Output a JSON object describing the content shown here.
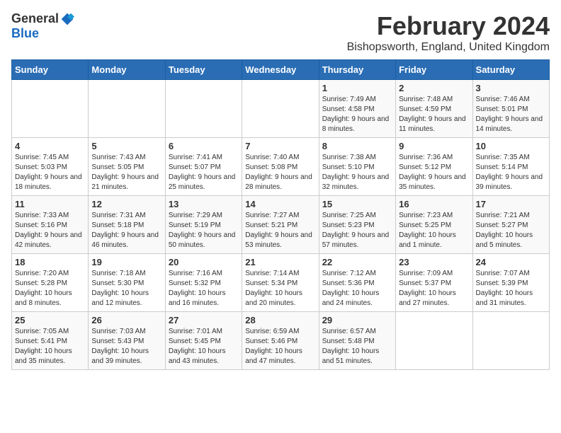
{
  "logo": {
    "general": "General",
    "blue": "Blue"
  },
  "title": "February 2024",
  "location": "Bishopsworth, England, United Kingdom",
  "days_of_week": [
    "Sunday",
    "Monday",
    "Tuesday",
    "Wednesday",
    "Thursday",
    "Friday",
    "Saturday"
  ],
  "weeks": [
    [
      {
        "day": "",
        "info": ""
      },
      {
        "day": "",
        "info": ""
      },
      {
        "day": "",
        "info": ""
      },
      {
        "day": "",
        "info": ""
      },
      {
        "day": "1",
        "info": "Sunrise: 7:49 AM\nSunset: 4:58 PM\nDaylight: 9 hours and 8 minutes."
      },
      {
        "day": "2",
        "info": "Sunrise: 7:48 AM\nSunset: 4:59 PM\nDaylight: 9 hours and 11 minutes."
      },
      {
        "day": "3",
        "info": "Sunrise: 7:46 AM\nSunset: 5:01 PM\nDaylight: 9 hours and 14 minutes."
      }
    ],
    [
      {
        "day": "4",
        "info": "Sunrise: 7:45 AM\nSunset: 5:03 PM\nDaylight: 9 hours and 18 minutes."
      },
      {
        "day": "5",
        "info": "Sunrise: 7:43 AM\nSunset: 5:05 PM\nDaylight: 9 hours and 21 minutes."
      },
      {
        "day": "6",
        "info": "Sunrise: 7:41 AM\nSunset: 5:07 PM\nDaylight: 9 hours and 25 minutes."
      },
      {
        "day": "7",
        "info": "Sunrise: 7:40 AM\nSunset: 5:08 PM\nDaylight: 9 hours and 28 minutes."
      },
      {
        "day": "8",
        "info": "Sunrise: 7:38 AM\nSunset: 5:10 PM\nDaylight: 9 hours and 32 minutes."
      },
      {
        "day": "9",
        "info": "Sunrise: 7:36 AM\nSunset: 5:12 PM\nDaylight: 9 hours and 35 minutes."
      },
      {
        "day": "10",
        "info": "Sunrise: 7:35 AM\nSunset: 5:14 PM\nDaylight: 9 hours and 39 minutes."
      }
    ],
    [
      {
        "day": "11",
        "info": "Sunrise: 7:33 AM\nSunset: 5:16 PM\nDaylight: 9 hours and 42 minutes."
      },
      {
        "day": "12",
        "info": "Sunrise: 7:31 AM\nSunset: 5:18 PM\nDaylight: 9 hours and 46 minutes."
      },
      {
        "day": "13",
        "info": "Sunrise: 7:29 AM\nSunset: 5:19 PM\nDaylight: 9 hours and 50 minutes."
      },
      {
        "day": "14",
        "info": "Sunrise: 7:27 AM\nSunset: 5:21 PM\nDaylight: 9 hours and 53 minutes."
      },
      {
        "day": "15",
        "info": "Sunrise: 7:25 AM\nSunset: 5:23 PM\nDaylight: 9 hours and 57 minutes."
      },
      {
        "day": "16",
        "info": "Sunrise: 7:23 AM\nSunset: 5:25 PM\nDaylight: 10 hours and 1 minute."
      },
      {
        "day": "17",
        "info": "Sunrise: 7:21 AM\nSunset: 5:27 PM\nDaylight: 10 hours and 5 minutes."
      }
    ],
    [
      {
        "day": "18",
        "info": "Sunrise: 7:20 AM\nSunset: 5:28 PM\nDaylight: 10 hours and 8 minutes."
      },
      {
        "day": "19",
        "info": "Sunrise: 7:18 AM\nSunset: 5:30 PM\nDaylight: 10 hours and 12 minutes."
      },
      {
        "day": "20",
        "info": "Sunrise: 7:16 AM\nSunset: 5:32 PM\nDaylight: 10 hours and 16 minutes."
      },
      {
        "day": "21",
        "info": "Sunrise: 7:14 AM\nSunset: 5:34 PM\nDaylight: 10 hours and 20 minutes."
      },
      {
        "day": "22",
        "info": "Sunrise: 7:12 AM\nSunset: 5:36 PM\nDaylight: 10 hours and 24 minutes."
      },
      {
        "day": "23",
        "info": "Sunrise: 7:09 AM\nSunset: 5:37 PM\nDaylight: 10 hours and 27 minutes."
      },
      {
        "day": "24",
        "info": "Sunrise: 7:07 AM\nSunset: 5:39 PM\nDaylight: 10 hours and 31 minutes."
      }
    ],
    [
      {
        "day": "25",
        "info": "Sunrise: 7:05 AM\nSunset: 5:41 PM\nDaylight: 10 hours and 35 minutes."
      },
      {
        "day": "26",
        "info": "Sunrise: 7:03 AM\nSunset: 5:43 PM\nDaylight: 10 hours and 39 minutes."
      },
      {
        "day": "27",
        "info": "Sunrise: 7:01 AM\nSunset: 5:45 PM\nDaylight: 10 hours and 43 minutes."
      },
      {
        "day": "28",
        "info": "Sunrise: 6:59 AM\nSunset: 5:46 PM\nDaylight: 10 hours and 47 minutes."
      },
      {
        "day": "29",
        "info": "Sunrise: 6:57 AM\nSunset: 5:48 PM\nDaylight: 10 hours and 51 minutes."
      },
      {
        "day": "",
        "info": ""
      },
      {
        "day": "",
        "info": ""
      }
    ]
  ]
}
